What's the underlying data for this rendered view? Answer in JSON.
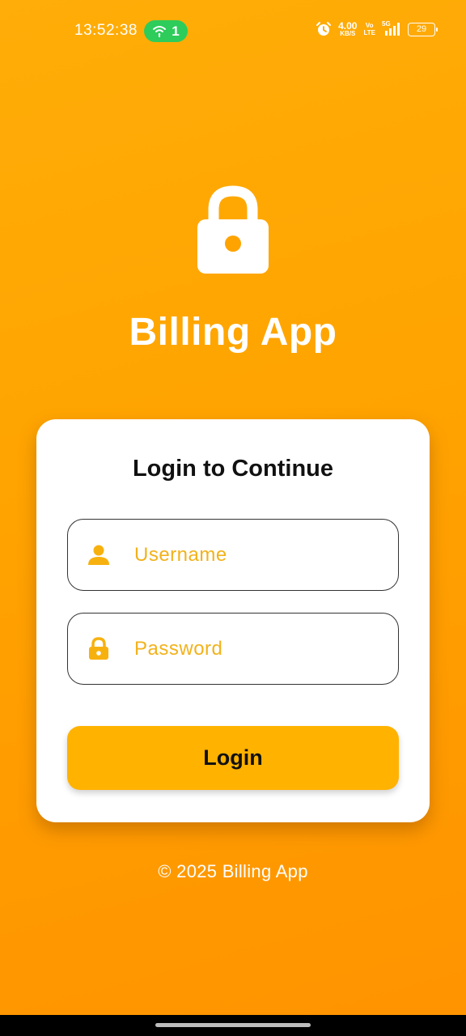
{
  "status_bar": {
    "time": "13:52:38",
    "hotspot_count": "1",
    "speed_value": "4.00",
    "speed_unit": "KB/S",
    "volte_top": "Vo",
    "volte_bottom": "LTE",
    "network": "5G",
    "battery_level": "29",
    "icons": [
      "hotspot-icon",
      "alarm-icon",
      "signal-icon",
      "battery-icon"
    ]
  },
  "hero": {
    "icon": "lock-icon",
    "title": "Billing App"
  },
  "login_card": {
    "title": "Login to Continue",
    "username": {
      "icon": "person-icon",
      "placeholder": "Username",
      "value": ""
    },
    "password": {
      "icon": "lock-icon",
      "placeholder": "Password",
      "value": ""
    },
    "login_label": "Login"
  },
  "footer": {
    "text": "© 2025 Billing App"
  },
  "colors": {
    "background_start": "#ffad08",
    "background_end": "#ff9300",
    "accent": "#ffb200",
    "placeholder": "#f2b21b",
    "icon": "#f7b10f",
    "hotspot_pill": "#2ecc5a"
  }
}
